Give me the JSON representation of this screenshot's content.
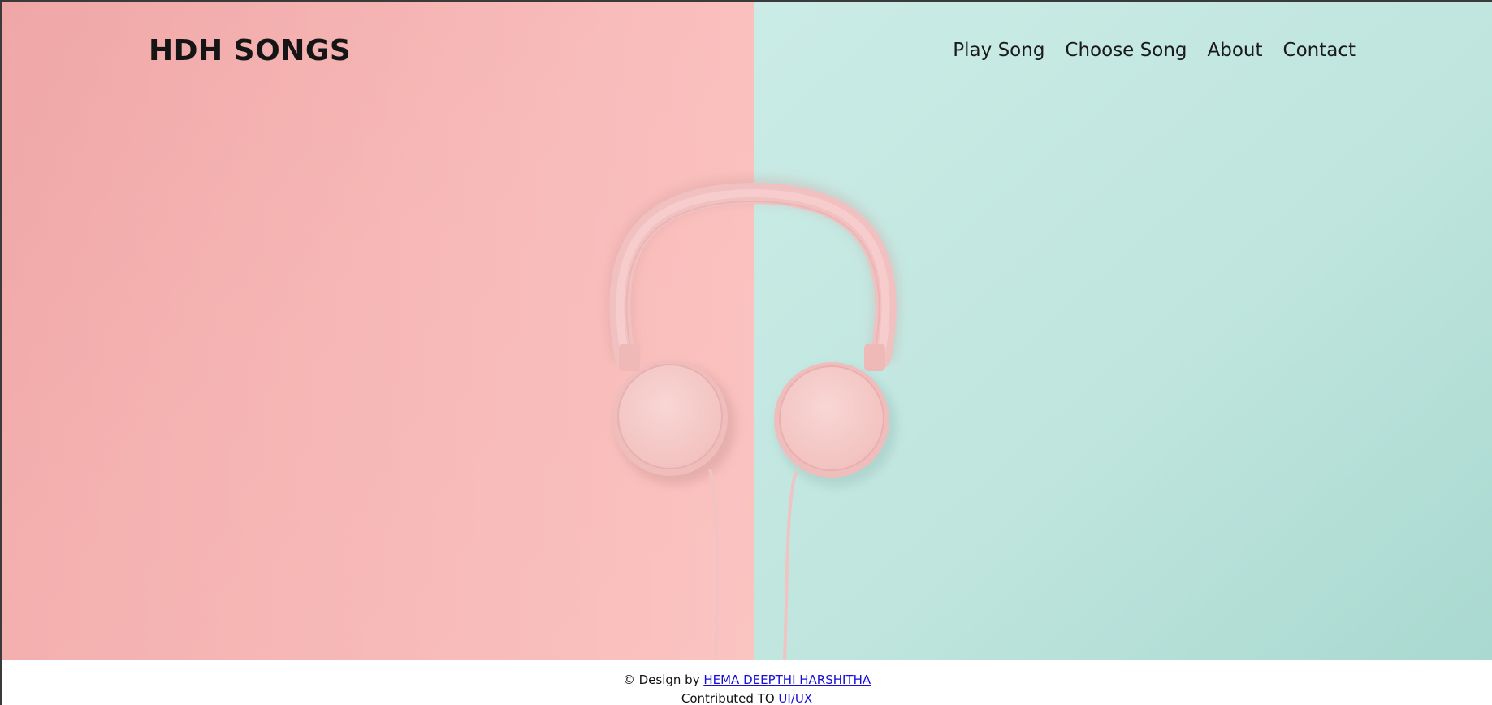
{
  "header": {
    "brand": "HDH SONGS",
    "nav": [
      {
        "label": "Play Song"
      },
      {
        "label": "Choose Song"
      },
      {
        "label": "About"
      },
      {
        "label": "Contact"
      }
    ]
  },
  "hero": {
    "image": "pink-headphones-on-split-pink-mint-background",
    "colors": {
      "left_bg": "#f8b9b7",
      "right_bg": "#bfe6df",
      "headphones": "#f6c8c8"
    }
  },
  "footer": {
    "design_prefix": "© Design by ",
    "designer_name": "HEMA DEEPTHI HARSHITHA",
    "contributed_prefix": "Contributed TO ",
    "contributed_link": "UI/UX"
  },
  "colors": {
    "link": "#1a0dd8",
    "text": "#151515"
  }
}
